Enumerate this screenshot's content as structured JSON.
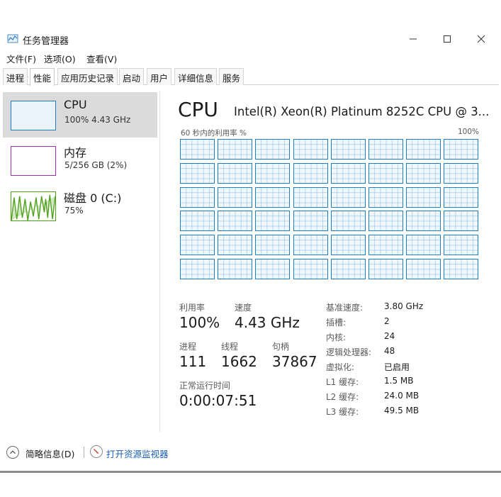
{
  "window": {
    "title": "任务管理器",
    "controls": {
      "minimize": "—",
      "maximize": "☐",
      "close": "✕"
    }
  },
  "menu": [
    "文件(F)",
    "选项(O)",
    "查看(V)"
  ],
  "tabs": [
    "进程",
    "性能",
    "应用历史记录",
    "启动",
    "用户",
    "详细信息",
    "服务"
  ],
  "active_tab": "性能",
  "sidebar": {
    "items": [
      {
        "name": "CPU",
        "value": "100% 4.43 GHz",
        "color": "#1c7ec7",
        "selected": true
      },
      {
        "name": "内存",
        "value": "5/256 GB (2%)",
        "color": "#9c2fae"
      },
      {
        "name": "磁盘 0 (C:)",
        "value": "75%",
        "color": "#4da117"
      }
    ]
  },
  "cpu": {
    "title": "CPU",
    "model": "Intel(R) Xeon(R) Platinum 8252C CPU @ 3...",
    "graph_caption_left": "60 秒内的利用率 %",
    "graph_caption_right": "100%",
    "logical_processor_graphs": 48,
    "graph_utilization_pct": 100,
    "stats": {
      "utilization_label": "利用率",
      "utilization": "100%",
      "speed_label": "速度",
      "speed": "4.43 GHz",
      "processes_label": "进程",
      "processes": "111",
      "threads_label": "线程",
      "threads": "1662",
      "handles_label": "句柄",
      "handles": "37867",
      "uptime_label": "正常运行时间",
      "uptime": "0:00:07:51"
    },
    "specs": [
      {
        "k": "基准速度:",
        "v": "3.80 GHz"
      },
      {
        "k": "插槽:",
        "v": "2"
      },
      {
        "k": "内核:",
        "v": "24"
      },
      {
        "k": "逻辑处理器:",
        "v": "48"
      },
      {
        "k": "虚拟化:",
        "v": "已启用"
      },
      {
        "k": "L1 缓存:",
        "v": "1.5 MB"
      },
      {
        "k": "L2 缓存:",
        "v": "24.0 MB"
      },
      {
        "k": "L3 缓存:",
        "v": "49.5 MB"
      }
    ]
  },
  "footer": {
    "fewer_details": "简略信息(D)",
    "open_monitor": "打开资源监视器"
  },
  "icons": {
    "app": "task-manager-icon",
    "fewer": "chevron-up-icon",
    "monitor": "resource-monitor-icon"
  }
}
